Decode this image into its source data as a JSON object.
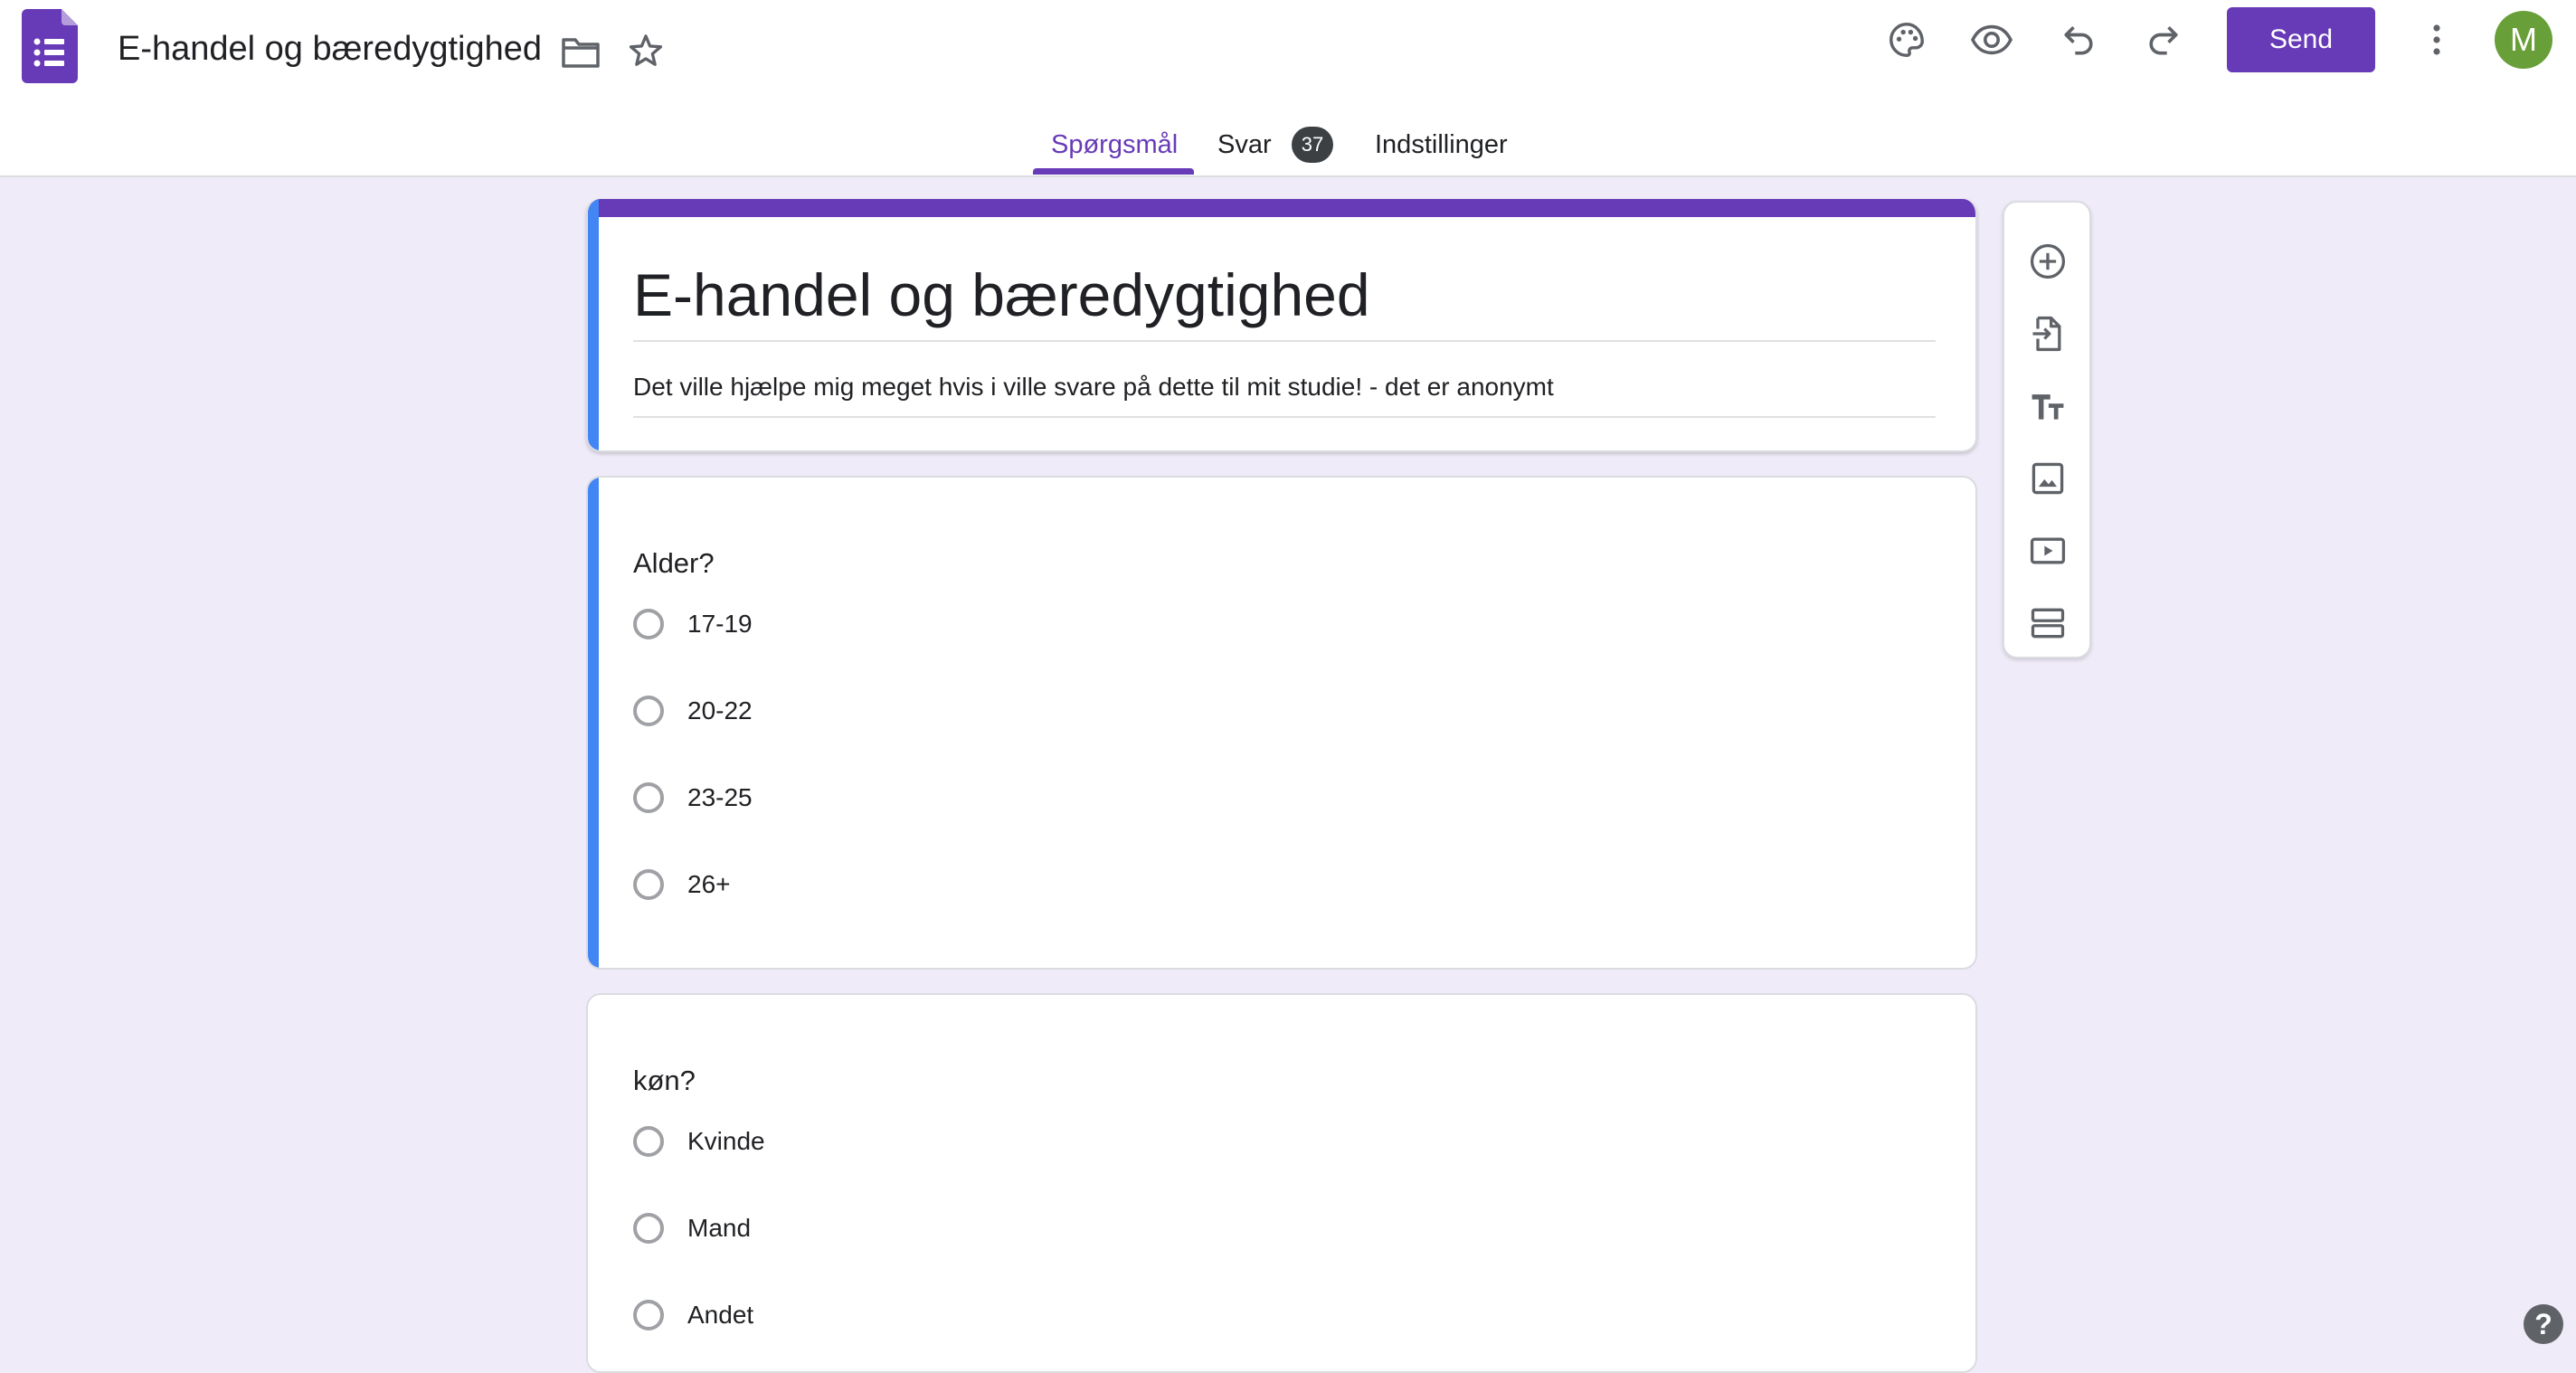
{
  "header": {
    "doc_title": "E-handel og bæredygtighed",
    "send_label": "Send",
    "avatar_initial": "M",
    "icons": [
      "forms-logo-icon",
      "folder-icon",
      "star-icon",
      "palette-icon",
      "preview-eye-icon",
      "undo-icon",
      "redo-icon",
      "more-vert-icon"
    ]
  },
  "tabs": [
    {
      "label": "Spørgsmål",
      "active": true
    },
    {
      "label": "Svar",
      "badge": "37"
    },
    {
      "label": "Indstillinger"
    }
  ],
  "form": {
    "title": "E-handel og bæredygtighed",
    "description": "Det ville hjælpe mig meget hvis i ville svare på dette til mit studie! - det er anonymt"
  },
  "questions": [
    {
      "title": "Alder?",
      "options": [
        "17-19",
        "20-22",
        "23-25",
        "26+"
      ]
    },
    {
      "title": "køn?",
      "options": [
        "Kvinde",
        "Mand",
        "Andet"
      ]
    }
  ],
  "toolbar": {
    "icons": [
      "add-question-icon",
      "import-questions-icon",
      "add-title-icon",
      "add-image-icon",
      "add-video-icon",
      "add-section-icon"
    ]
  },
  "help_label": "?",
  "colors": {
    "accent": "#673ab7",
    "background": "#f0ebf8",
    "active_card": "#4285f4",
    "avatar": "#689f38"
  }
}
